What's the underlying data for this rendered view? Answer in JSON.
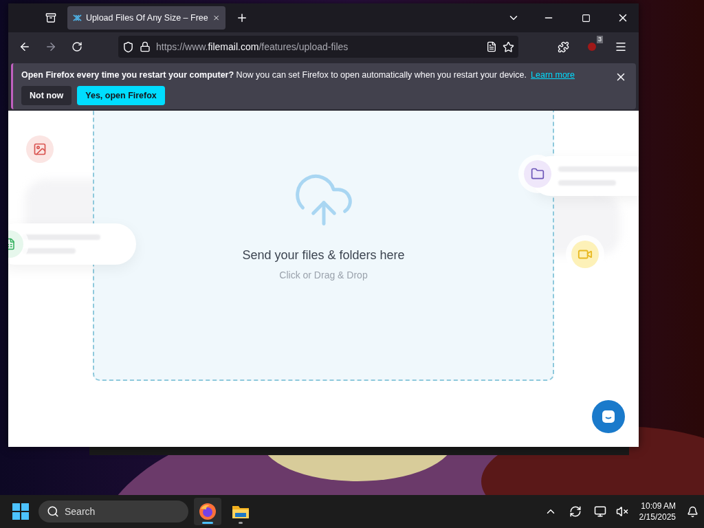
{
  "browser": {
    "tabs": [
      {
        "title": "Upload Files Of Any Size – Free",
        "selected": true
      }
    ],
    "url": {
      "prefix": "https://www.",
      "domain": "filemail.com",
      "path": "/features/upload-files"
    },
    "extension_badge": "3"
  },
  "notification": {
    "title": "Open Firefox every time you restart your computer?",
    "message": "Now you can set Firefox to open automatically when you restart your device.",
    "link": "Learn more",
    "buttons": [
      {
        "label": "Not now",
        "kind": "secondary"
      },
      {
        "label": "Yes, open Firefox",
        "kind": "primary"
      }
    ]
  },
  "page": {
    "dropzone": {
      "title": "Send your files & folders here",
      "subtitle": "Click or Drag & Drop"
    }
  },
  "taskbar": {
    "search_placeholder": "Search",
    "apps": [
      {
        "kind": "firefox",
        "selected": true
      },
      {
        "kind": "explorer",
        "selected": false
      }
    ],
    "time": "10:09 AM",
    "date": "2/15/2025"
  }
}
